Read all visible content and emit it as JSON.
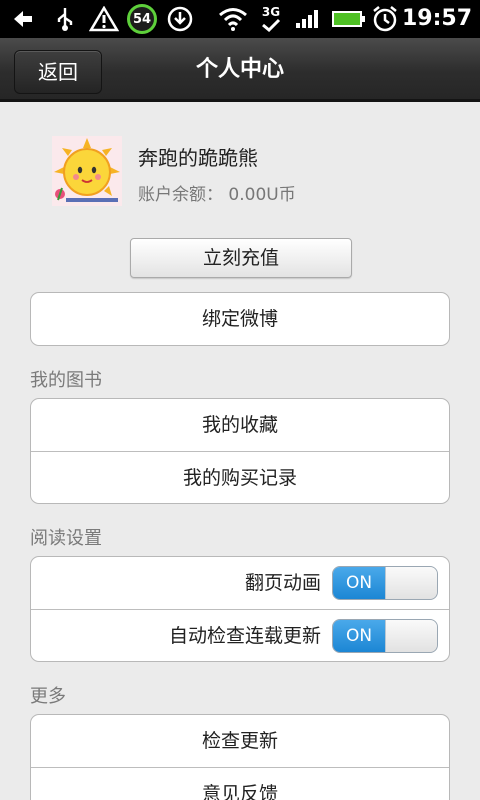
{
  "status_bar": {
    "battery_badge": "54",
    "network_type": "3G",
    "time": "19:57"
  },
  "header": {
    "back_label": "返回",
    "title": "个人中心"
  },
  "profile": {
    "username": "奔跑的跪跪熊",
    "balance_label": "账户余额：",
    "balance_value": "0.00U币"
  },
  "actions": {
    "recharge_label": "立刻充值",
    "bind_weibo_label": "绑定微博"
  },
  "my_books": {
    "section_title": "我的图书",
    "items": [
      {
        "label": "我的收藏"
      },
      {
        "label": "我的购买记录"
      }
    ]
  },
  "reading_settings": {
    "section_title": "阅读设置",
    "items": [
      {
        "label": "翻页动画",
        "toggle": "ON"
      },
      {
        "label": "自动检查连载更新",
        "toggle": "ON"
      }
    ]
  },
  "more": {
    "section_title": "更多",
    "items": [
      {
        "label": "检查更新"
      },
      {
        "label": "意见反馈"
      }
    ]
  },
  "colors": {
    "toggle_on": "#1c86d4",
    "status_badge": "#5ed03b",
    "title_bar": "#2d2d2d"
  }
}
